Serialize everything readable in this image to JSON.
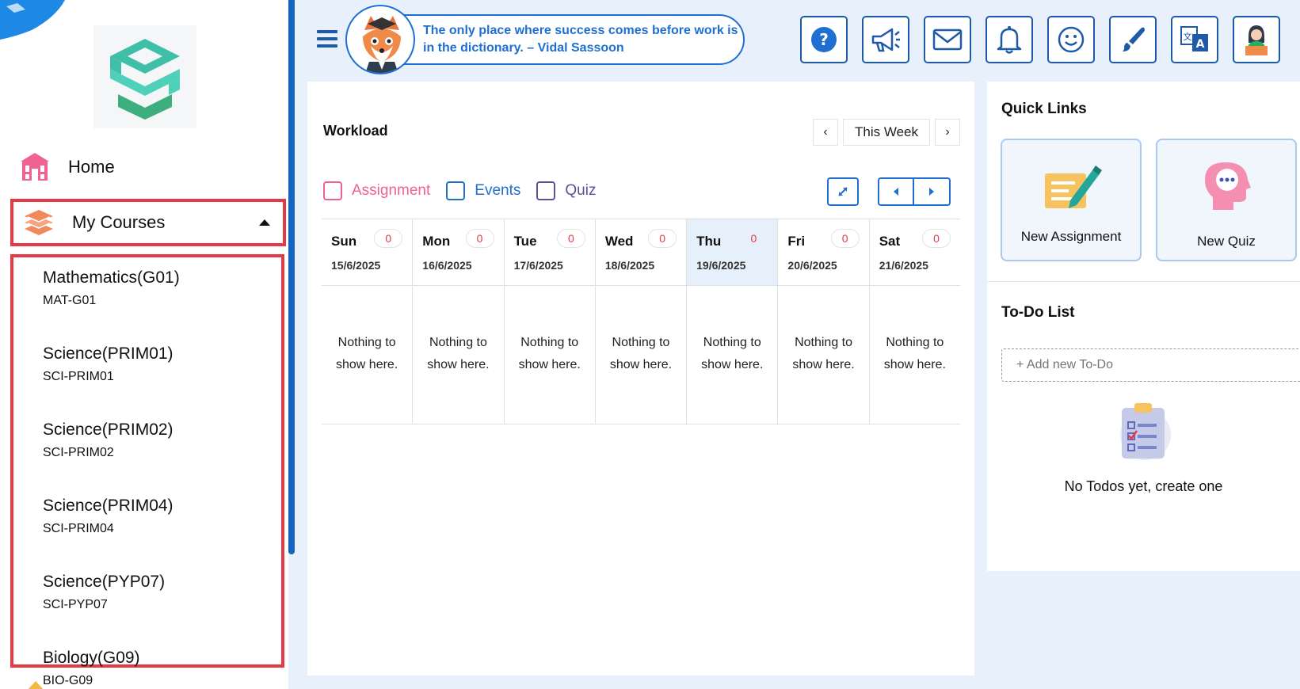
{
  "sidebar": {
    "home_label": "Home",
    "courses_label": "My Courses",
    "courses": [
      {
        "name": "Mathematics(G01)",
        "code": "MAT-G01"
      },
      {
        "name": "Science(PRIM01)",
        "code": "SCI-PRIM01"
      },
      {
        "name": "Science(PRIM02)",
        "code": "SCI-PRIM02"
      },
      {
        "name": "Science(PRIM04)",
        "code": "SCI-PRIM04"
      },
      {
        "name": "Science(PYP07)",
        "code": "SCI-PYP07"
      },
      {
        "name": "Biology(G09)",
        "code": "BIO-G09"
      }
    ]
  },
  "header": {
    "quote": "The only place where success comes before work is in the dictionary. – Vidal Sassoon",
    "buttons": [
      "help-icon",
      "megaphone-icon",
      "mail-icon",
      "bell-icon",
      "smiley-icon",
      "paintbrush-icon",
      "translate-icon",
      "profile-icon"
    ]
  },
  "workload": {
    "title": "Workload",
    "week_label": "This Week",
    "filters": [
      {
        "label": "Assignment",
        "color": "#f06292"
      },
      {
        "label": "Events",
        "color": "#1e6fd0"
      },
      {
        "label": "Quiz",
        "color": "#5c4f9c"
      }
    ],
    "days": [
      {
        "name": "Sun",
        "date": "15/6/2025",
        "count": "0",
        "empty": "Nothing to show here."
      },
      {
        "name": "Mon",
        "date": "16/6/2025",
        "count": "0",
        "empty": "Nothing to show here."
      },
      {
        "name": "Tue",
        "date": "17/6/2025",
        "count": "0",
        "empty": "Nothing to show here."
      },
      {
        "name": "Wed",
        "date": "18/6/2025",
        "count": "0",
        "empty": "Nothing to show here."
      },
      {
        "name": "Thu",
        "date": "19/6/2025",
        "count": "0",
        "empty": "Nothing to show here.",
        "today": true
      },
      {
        "name": "Fri",
        "date": "20/6/2025",
        "count": "0",
        "empty": "Nothing to show here."
      },
      {
        "name": "Sat",
        "date": "21/6/2025",
        "count": "0",
        "empty": "Nothing to show here."
      }
    ]
  },
  "quick_links": {
    "title": "Quick Links",
    "new_assignment": "New Assignment",
    "new_quiz": "New Quiz"
  },
  "todo": {
    "title": "To-Do List",
    "placeholder": "+ Add new To-Do",
    "empty": "No Todos yet, create one"
  },
  "colors": {
    "accent": "#1e6fd0",
    "highlight_border": "#e53945",
    "count_text": "#e53945",
    "today_bg": "#e6f0fb"
  }
}
